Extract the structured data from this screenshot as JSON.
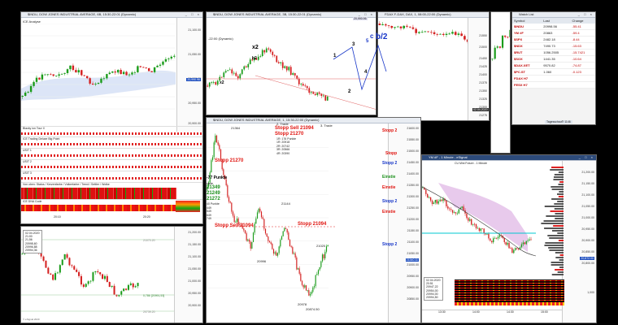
{
  "windows": {
    "top_left": {
      "title": "$INDU, DOW JONES INDUSTRIAL AVERAGE, 6B, 15:30-22:01 (Dynamic)",
      "subtitle": "ICE Analyse",
      "axis": [
        "21,100.00",
        "21,050.00",
        "21,000.00",
        "20,950.00",
        "20,900.00"
      ],
      "price_tag": "20,990.96",
      "indicator_rows": [
        "Blacky ion Tour II",
        "ICE Trading Deluxe Big Point",
        "USIT 1",
        "USIT 2",
        "USIT 3",
        "Von oben: Status / Kerzenfarbe / Volkerfarbe / Trend / Settler / Wolke",
        "ICE DNA Code"
      ],
      "time_labels": [
        "20:10",
        "20:20"
      ]
    },
    "top_mid": {
      "title": "$INDU, DOW JONES INDUSTRIAL AVERAGE, 3B, 15:30-22:01 (Dynamic)",
      "subtitle": "-22:00 (Dynamic)",
      "value_top": "20,990.96",
      "wave_labels": [
        "x2",
        "b2",
        "x2",
        "1",
        "3",
        "2",
        "4",
        "5",
        "a",
        "c"
      ]
    },
    "top_right": {
      "title": "FDAX F-DAX, DAX, 1, 08:00-22:00 (Dynamic)",
      "date_tag": "02.04.2020",
      "axis": [
        "21550",
        "21500",
        "21450",
        "21425",
        "21400",
        "21375",
        "21350",
        "21325",
        "21300",
        "21275",
        "21250",
        "21225",
        "21200",
        "21175",
        "21150",
        "21125"
      ],
      "wave_text": [
        "1",
        "3",
        "4",
        "2",
        "c",
        "b/2",
        "5"
      ]
    },
    "main": {
      "title": "$INDU, DOW JONES INDUSTRIAL AVERAGE, 1, 15:30-22:00 (Dynamic)",
      "header_lines": [
        "2. Trade",
        "1R: 176 Punkte",
        "1R: 20918",
        "2R: 20742",
        "3R: 20566",
        "4R: 20390"
      ],
      "trade3": "3. Trade",
      "stopp_sell": "Stopp Sell 21094",
      "stopp_21270_top": "Stopp 21270",
      "stopp_21270": "Stopp 21270",
      "stopp_sell_mid": "Stopp Sell 21094",
      "stopp_21094": "Stopp 21094",
      "points_label": "-77 Punkte",
      "points_sub": "rade",
      "green_vals": [
        "21349",
        "21249",
        "21272"
      ],
      "small_vals": [
        "40 Punkte",
        "449",
        "549",
        "649",
        "749"
      ],
      "price_labels": [
        "21364",
        "21144",
        "20996",
        "21020",
        "20978",
        "20874.50"
      ],
      "axis": [
        "21600.00",
        "21550.00",
        "21500.00",
        "21450.00",
        "21400.00",
        "21350.00",
        "21300.00",
        "21250.00",
        "21200.00",
        "21150.00",
        "21100.00",
        "21050.00",
        "21000.00",
        "20950.00",
        "20900.00",
        "20850.00"
      ],
      "price_tag": "21340.11",
      "bottom_times": [
        "16:00",
        "17:00",
        "18:00",
        "19:00",
        "20:00"
      ],
      "right_stopp": [
        "Stopp 2",
        "Stopp",
        "Stopp 2",
        "Einstie",
        "Einstie",
        "Stopp 2",
        "Einstie",
        "Stopp 2"
      ]
    },
    "bottom_left": {
      "info": [
        "02.04.2020",
        "21:00",
        "21,56",
        "20998,60",
        "20996,88",
        "20994,36"
      ],
      "axis": [
        "21,200.00",
        "21,150.00",
        "21,100.00",
        "21,050.00",
        "21,000.00",
        "20,950.00",
        "20,900.00"
      ],
      "tag1": "21070.20",
      "tag2": "0,786 [20991,53]",
      "tag3": "20739.20",
      "footer": "© eSignal 2020"
    },
    "bottom_right": {
      "title": "YM #F - 1 Minute - eSignal",
      "sub": "CU Mini Future - 1 Minute",
      "axis": [
        "21,200.00",
        "21,150.00",
        "21,100.00",
        "21,050.00",
        "21,000.00",
        "20,950.00",
        "20,900.00",
        "20,850.00",
        "20,800.00"
      ],
      "price_tag": "20,872.00",
      "times": [
        "13:30",
        "14:00",
        "14:30",
        "15:00"
      ],
      "info": [
        "02.04.2020",
        "20:51",
        "20947,22",
        "20954,00",
        "20994,00",
        "20994,50"
      ],
      "vol_label": "1,000"
    },
    "quotes": {
      "title": "Watch List",
      "columns": [
        "Symbol",
        "Last",
        "Change"
      ],
      "rows": [
        {
          "sym": "$INDU",
          "last": "20998.56",
          "chg": "-55.41"
        },
        {
          "sym": "YM #F",
          "last": "20863",
          "chg": "-59.4"
        },
        {
          "sym": "$SPX",
          "last": "2482.18",
          "chg": "-8.44"
        },
        {
          "sym": "$NDX",
          "last": "7490.73",
          "chg": "-15.63"
        },
        {
          "sym": "$RUT",
          "last": "1056.2505",
          "chg": "-15.7421"
        },
        {
          "sym": "$SOX",
          "last": "1441.35",
          "chg": "-10.64"
        },
        {
          "sym": "$DAX.XET",
          "last": "9570.82",
          "chg": "-74.87"
        },
        {
          "sym": "$PC.ST",
          "last": "1.060",
          "chg": "-0.123"
        },
        {
          "sym": "FDAX H7",
          "last": "",
          "chg": ""
        },
        {
          "sym": "FESX H7",
          "last": "",
          "chg": ""
        }
      ],
      "footer": "Tagesschau® 1146"
    },
    "right_strip_axis": [
      "21500.00",
      "21450.00",
      "21400.00",
      "21350.00",
      "21300.00",
      "21250.00",
      "21200.00",
      "21150.00",
      "21100.00",
      "21050.00"
    ]
  },
  "colors": {
    "bull": "#1a9c1a",
    "bear": "#d42020",
    "accent_blue": "#1736c8",
    "ribbon_purple": "#d9a6e0"
  }
}
